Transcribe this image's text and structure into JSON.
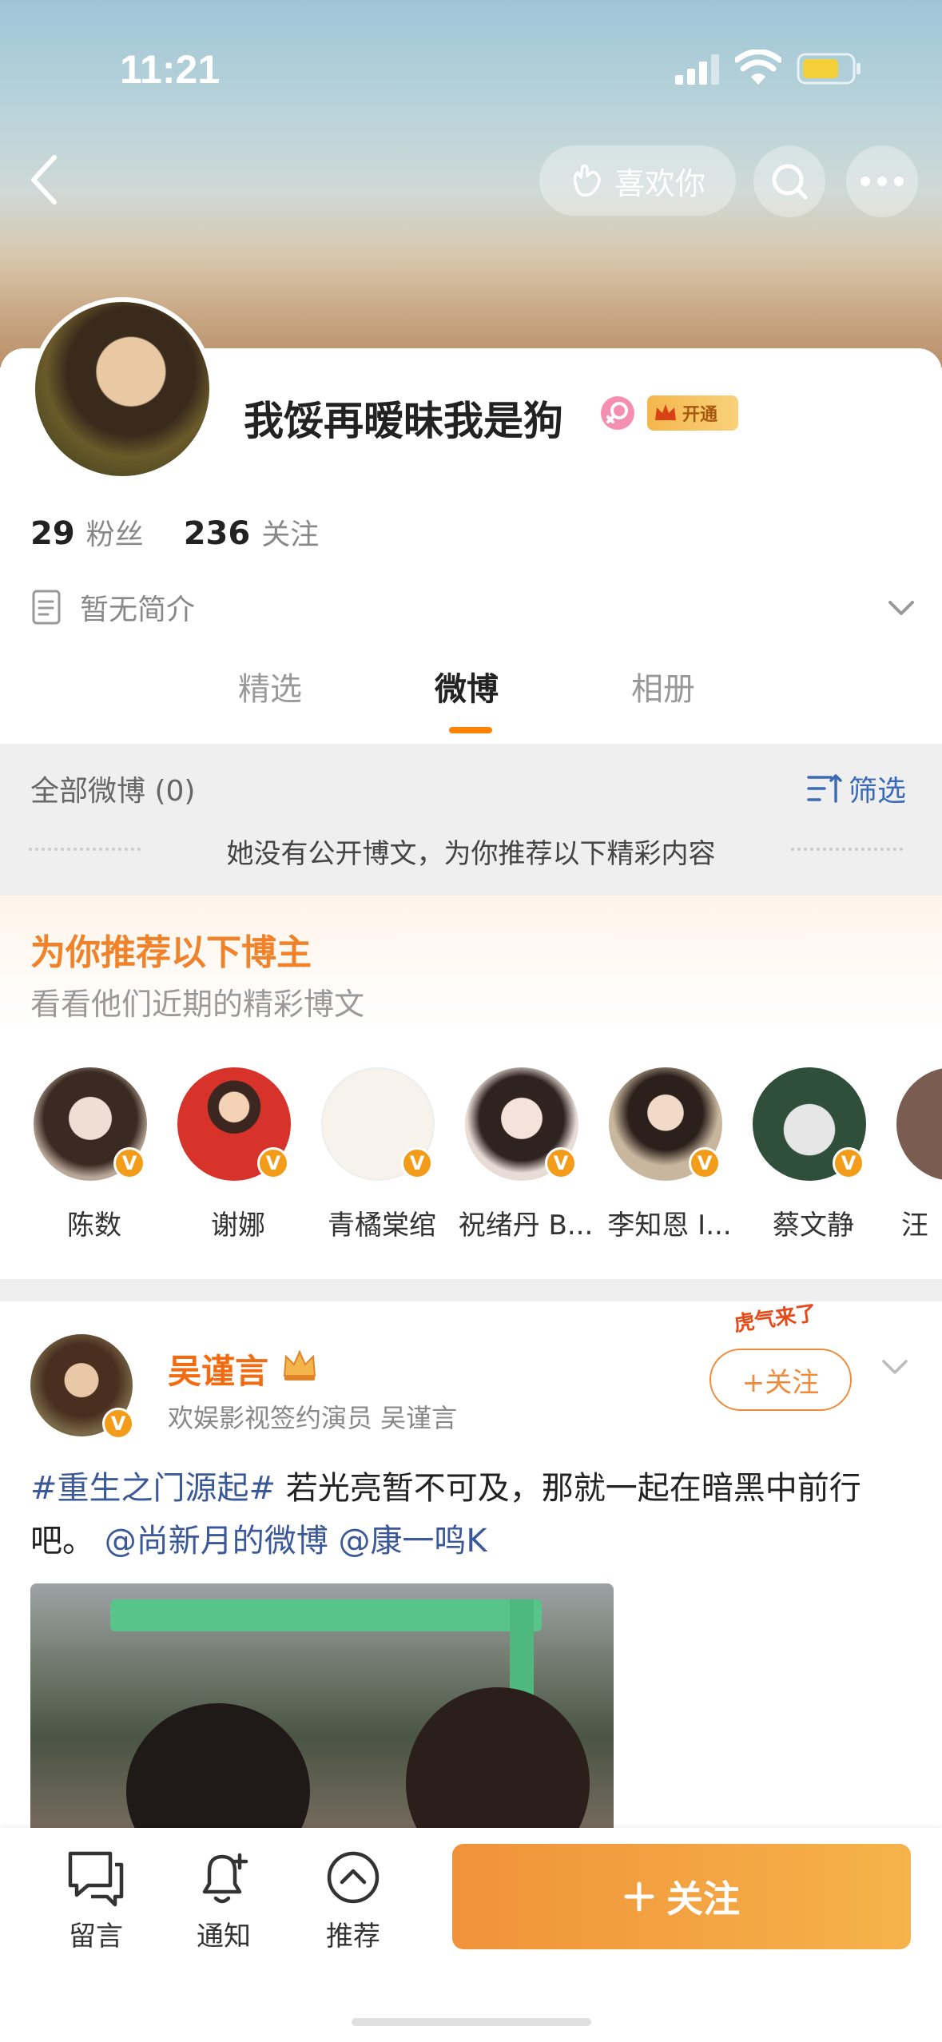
{
  "status_bar": {
    "time": "11:21"
  },
  "header": {
    "like_label": "喜欢你"
  },
  "profile": {
    "name": "我馁再暧昧我是狗",
    "vip_label": "开通",
    "followers_count": "29",
    "followers_label": "粉丝",
    "following_count": "236",
    "following_label": "关注",
    "bio": "暂无简介"
  },
  "tabs": [
    {
      "label": "精选"
    },
    {
      "label": "微博"
    },
    {
      "label": "相册"
    }
  ],
  "feed": {
    "all_label": "全部微博 (0)",
    "filter_label": "筛选",
    "empty_note": "她没有公开博文，为你推荐以下精彩内容"
  },
  "recommend": {
    "title": "为你推荐以下博主",
    "subtitle": "看看他们近期的精彩博文",
    "items": [
      {
        "name": "陈数"
      },
      {
        "name": "谢娜"
      },
      {
        "name": "青橘棠绾"
      },
      {
        "name": "祝绪丹 B..."
      },
      {
        "name": "李知恩 I..."
      },
      {
        "name": "蔡文静"
      },
      {
        "name": "汪"
      }
    ],
    "avatar_colors": [
      "#b9a89a",
      "#d7332a",
      "#f7f2ec",
      "#e8dcd7",
      "#c9b69e",
      "#2f4f3a",
      "#7a5d50"
    ]
  },
  "post": {
    "author": "吴谨言",
    "author_desc": "欢娱影视签约演员 吴谨言",
    "follow_label": "+关注",
    "promo_tag": "虎气来了",
    "hashtag": "#重生之门源起#",
    "text_main": " 若光亮暂不可及，那就一起在暗黑中前行吧。",
    "mention1": "@尚新月的微博",
    "mention2": "@康一鸣K"
  },
  "bottom_bar": {
    "comment_label": "留言",
    "notify_label": "通知",
    "recommend_label": "推荐",
    "follow_label": "关注"
  },
  "colors": {
    "accent_orange": "#ff8200",
    "link_blue": "#3b5998"
  }
}
